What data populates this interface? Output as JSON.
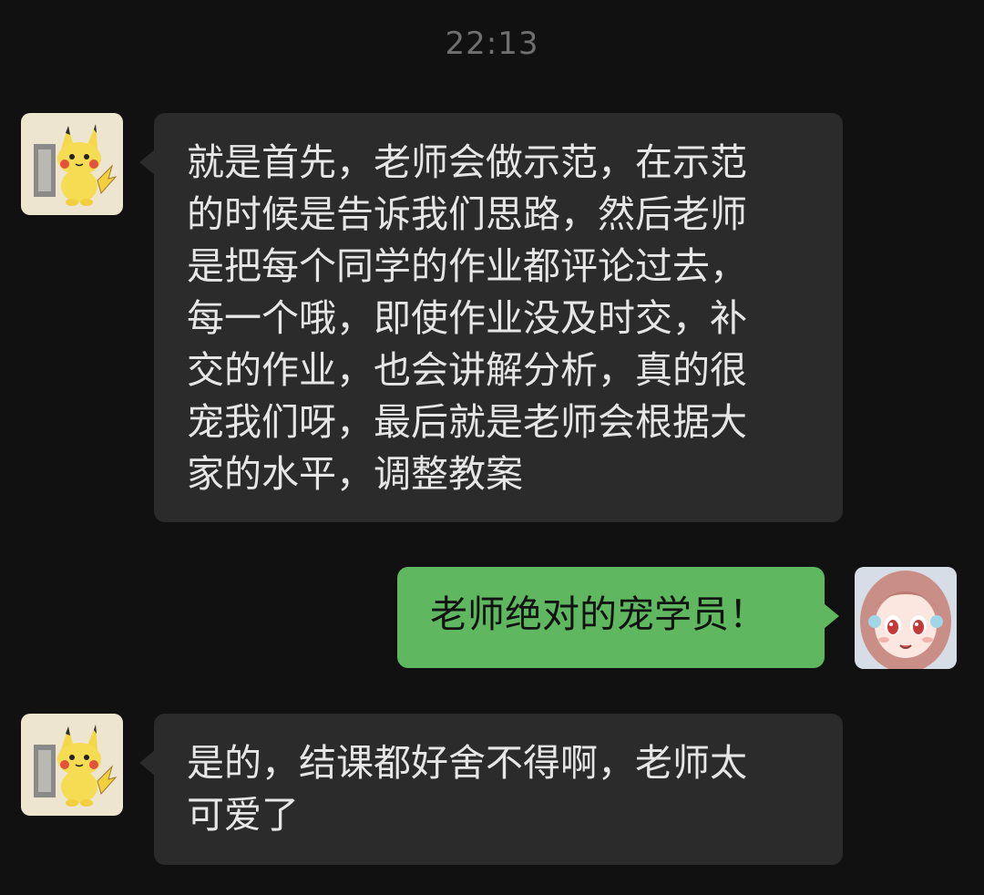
{
  "chat": {
    "timestamp": "22:13",
    "messages": [
      {
        "side": "incoming",
        "avatar_icon": "pikachu-avatar-icon",
        "text": "就是首先，老师会做示范，在示范\n的时候是告诉我们思路，然后老师\n是把每个同学的作业都评论过去，\n每一个哦，即使作业没及时交，补\n交的作业，也会讲解分析，真的很\n宠我们呀，最后就是老师会根据大\n家的水平，调整教案"
      },
      {
        "side": "outgoing",
        "avatar_icon": "anime-girl-avatar-icon",
        "text": "老师绝对的宠学员！"
      },
      {
        "side": "incoming",
        "avatar_icon": "pikachu-avatar-icon",
        "text": "是的，结课都好舍不得啊，老师太\n可爱了"
      }
    ]
  },
  "colors": {
    "background": "#111111",
    "incoming_bubble": "#2b2b2b",
    "outgoing_bubble": "#5fb760",
    "timestamp_text": "#6f6f6f"
  }
}
